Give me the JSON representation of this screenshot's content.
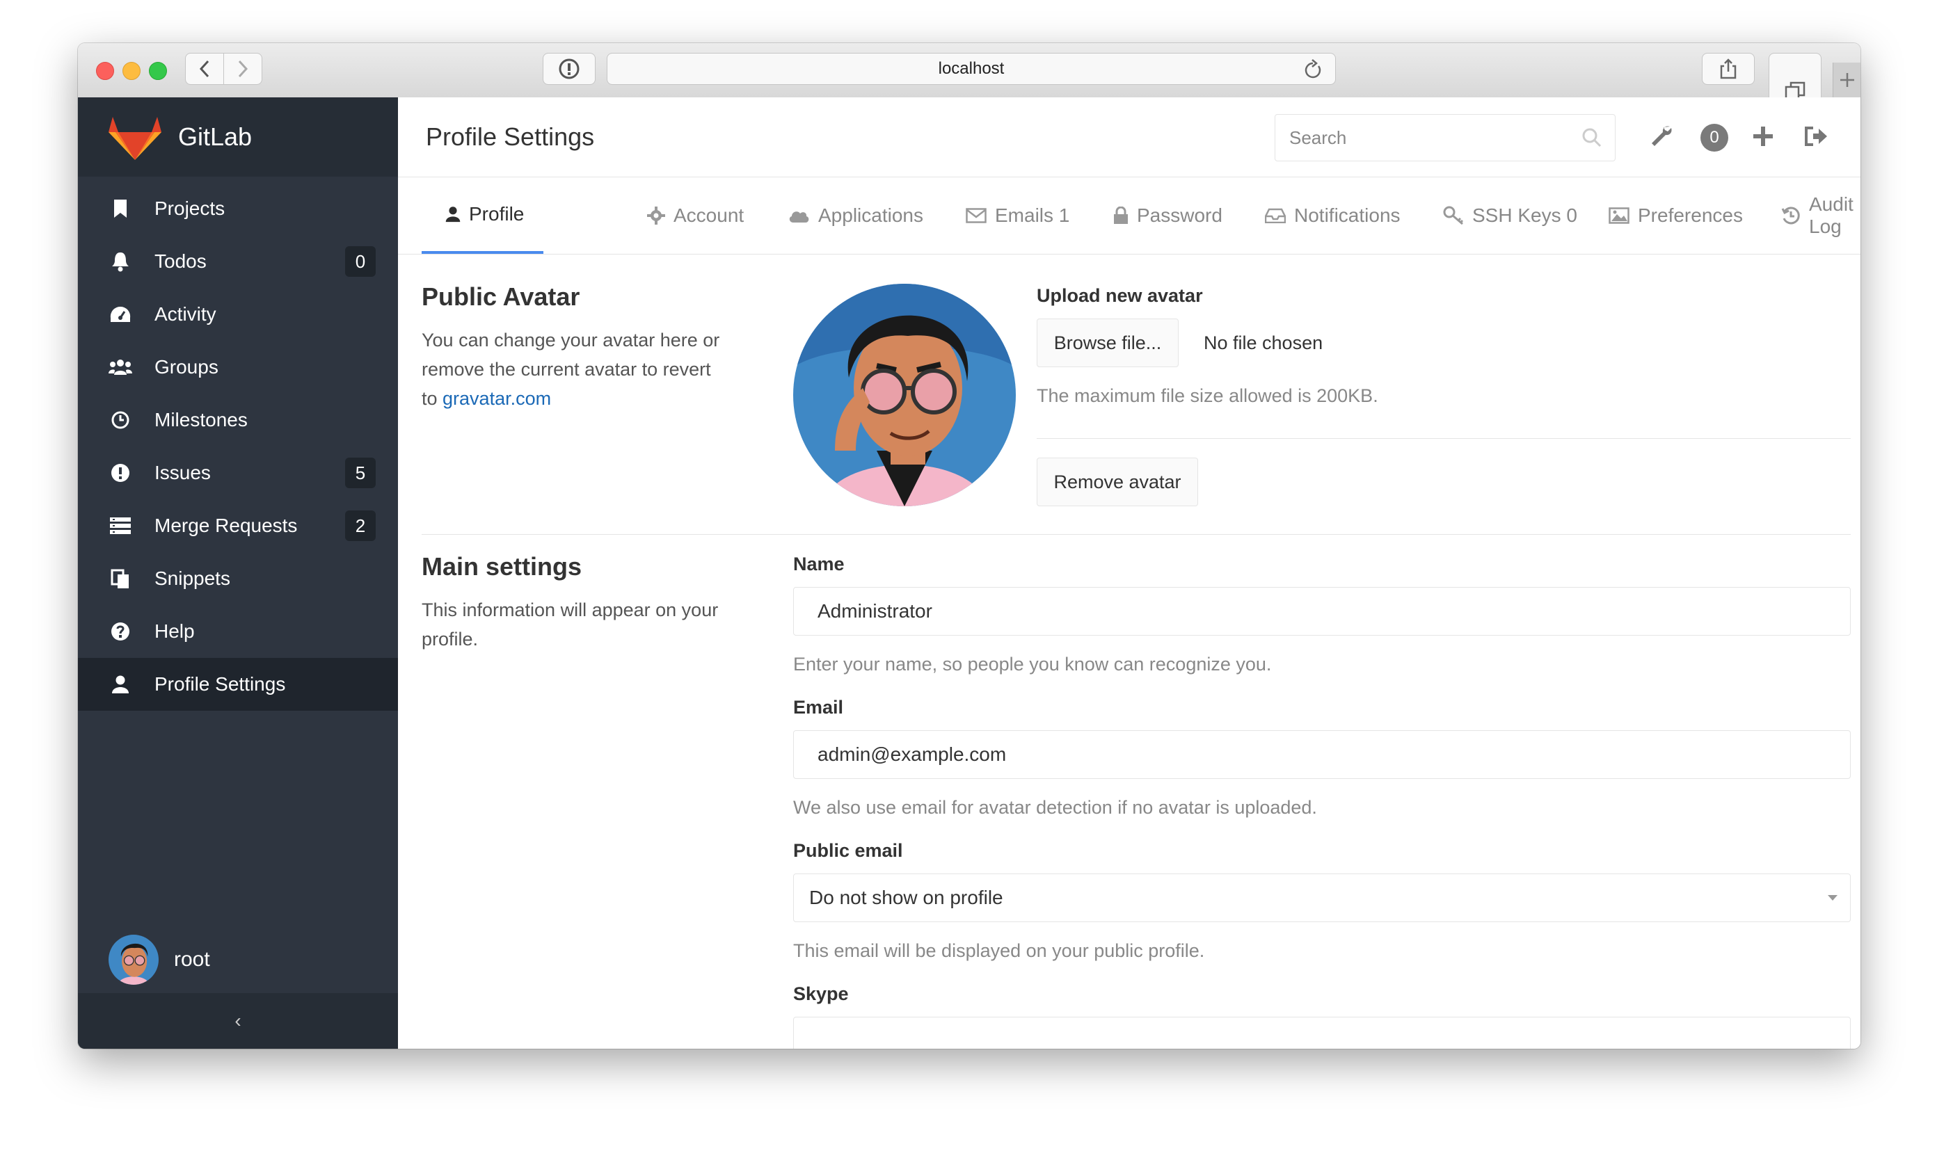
{
  "browser": {
    "url": "localhost"
  },
  "sidebar": {
    "brand": "GitLab",
    "items": [
      {
        "label": "Projects",
        "icon": "bookmark-icon"
      },
      {
        "label": "Todos",
        "icon": "bell-icon",
        "count": "0"
      },
      {
        "label": "Activity",
        "icon": "dashboard-icon"
      },
      {
        "label": "Groups",
        "icon": "users-icon"
      },
      {
        "label": "Milestones",
        "icon": "clock-icon"
      },
      {
        "label": "Issues",
        "icon": "exclamation-circle-icon",
        "count": "5"
      },
      {
        "label": "Merge Requests",
        "icon": "list-icon",
        "count": "2"
      },
      {
        "label": "Snippets",
        "icon": "clipboard-icon"
      },
      {
        "label": "Help",
        "icon": "question-circle-icon"
      },
      {
        "label": "Profile Settings",
        "icon": "user-icon",
        "active": true
      }
    ],
    "user": "root",
    "collapse": "‹"
  },
  "header": {
    "title": "Profile Settings",
    "search_placeholder": "Search",
    "todo_count": "0"
  },
  "tabs": [
    {
      "label": "Profile",
      "icon": "user-icon",
      "active": true
    },
    {
      "label": "Account",
      "icon": "gear-icon"
    },
    {
      "label": "Applications",
      "icon": "cloud-icon"
    },
    {
      "label": "Emails 1",
      "icon": "envelope-icon"
    },
    {
      "label": "Password",
      "icon": "lock-icon"
    },
    {
      "label": "Notifications",
      "icon": "inbox-icon"
    },
    {
      "label": "SSH Keys 0",
      "icon": "key-icon"
    },
    {
      "label": "Preferences",
      "icon": "image-icon"
    },
    {
      "label": "Audit Log",
      "icon": "history-icon"
    }
  ],
  "avatar_section": {
    "title": "Public Avatar",
    "desc_line1": "You can change your avatar here or",
    "desc_line2": "remove the current avatar to revert",
    "desc_line3_prefix": "to ",
    "desc_link": "gravatar.com",
    "upload_label": "Upload new avatar",
    "browse_button": "Browse file...",
    "no_file": "No file chosen",
    "max_size": "The maximum file size allowed is 200KB.",
    "remove_button": "Remove avatar"
  },
  "main_settings": {
    "title": "Main settings",
    "desc_line1": "This information will appear on your",
    "desc_line2": "profile.",
    "name_label": "Name",
    "name_value": "Administrator",
    "name_help": "Enter your name, so people you know can recognize you.",
    "email_label": "Email",
    "email_value": "admin@example.com",
    "email_help": "We also use email for avatar detection if no avatar is uploaded.",
    "public_email_label": "Public email",
    "public_email_value": "Do not show on profile",
    "public_email_help": "This email will be displayed on your public profile.",
    "skype_label": "Skype",
    "skype_value": ""
  },
  "colors": {
    "sidebar_bg": "#2e3540",
    "active_tab": "#4a8bee",
    "link": "#1b69b6"
  }
}
